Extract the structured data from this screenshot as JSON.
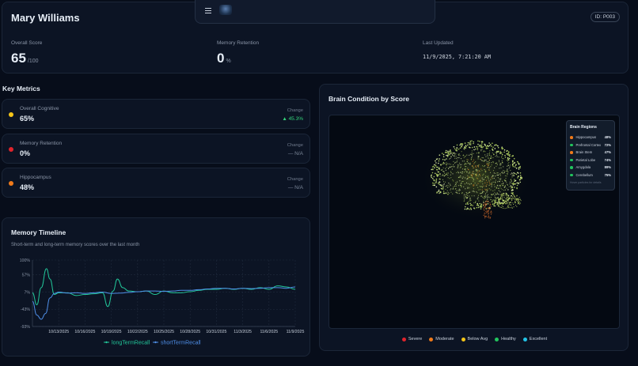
{
  "header": {
    "patient_name": "Mary Williams",
    "patient_id": "ID: P003",
    "overall_score_label": "Overall Score",
    "overall_score_value": "65",
    "overall_score_unit": "/100",
    "memory_retention_label": "Memory Retention",
    "memory_retention_value": "0",
    "memory_retention_unit": "%",
    "last_updated_label": "Last Updated",
    "last_updated_value": "11/9/2025, 7:21:20 AM"
  },
  "nav": {
    "menu_icon": "hamburger-menu-icon",
    "logo_icon": "brain-logo-icon"
  },
  "key_metrics": {
    "title": "Key Metrics",
    "items": [
      {
        "label": "Overall Cognitive",
        "value": "65%",
        "change_label": "Change",
        "change_value": "▲ 45.3%",
        "color": "#f5c518",
        "trend": "up"
      },
      {
        "label": "Memory Retention",
        "value": "0%",
        "change_label": "Change",
        "change_value": "— N/A",
        "color": "#e0242c",
        "trend": "none"
      },
      {
        "label": "Hippocampus",
        "value": "48%",
        "change_label": "Change",
        "change_value": "— N/A",
        "color": "#f07a1a",
        "trend": "none"
      }
    ]
  },
  "timeline": {
    "title": "Memory Timeline",
    "subtitle": "Short-term and long-term memory scores over the last month"
  },
  "chart_data": {
    "type": "line",
    "title": "Memory Timeline",
    "xlabel": "",
    "ylabel": "",
    "y_ticks": [
      "100%",
      "57%",
      "7%",
      "-43%",
      "-93%"
    ],
    "y_tick_values": [
      100,
      57,
      7,
      -43,
      -93
    ],
    "ylim": [
      -93,
      100
    ],
    "x_tick_labels": [
      "10/13/2025",
      "10/16/2025",
      "10/19/2025",
      "10/22/2025",
      "10/25/2025",
      "10/28/2025",
      "10/31/2025",
      "11/3/2025",
      "11/6/2025",
      "11/9/2025"
    ],
    "x_tick_days": [
      3,
      6,
      9,
      12,
      15,
      18,
      21,
      24,
      27,
      30
    ],
    "xlim": [
      0,
      30
    ],
    "grid": true,
    "legend_position": "bottom",
    "series": [
      {
        "name": "longTermRecall",
        "color": "#22c79a",
        "x": [
          0,
          0.5,
          1,
          1.6,
          2,
          2.5,
          3,
          4,
          5,
          6,
          7,
          8,
          8.6,
          9.2,
          9.7,
          10.3,
          11,
          12,
          13,
          14,
          15,
          16,
          17,
          18,
          19,
          20,
          21,
          22,
          23,
          24,
          25,
          26,
          27,
          28,
          29,
          30
        ],
        "y": [
          5,
          -30,
          20,
          75,
          45,
          0,
          5,
          5,
          -3,
          0,
          2,
          5,
          -35,
          10,
          45,
          20,
          10,
          8,
          10,
          0,
          10,
          5,
          5,
          8,
          12,
          15,
          15,
          18,
          15,
          18,
          15,
          20,
          15,
          25,
          22,
          15
        ]
      },
      {
        "name": "shortTermRecall",
        "color": "#4f8fe8",
        "x": [
          0,
          0.5,
          1,
          1.5,
          2,
          2.5,
          3,
          4,
          5,
          6,
          7,
          8,
          9,
          10,
          11,
          12,
          13,
          14,
          15,
          16,
          17,
          18,
          19,
          20,
          21,
          22,
          23,
          24,
          25,
          26,
          27,
          28,
          29,
          30
        ],
        "y": [
          -20,
          -60,
          -72,
          -55,
          -10,
          3,
          7,
          4,
          5,
          3,
          5,
          7,
          3,
          4,
          6,
          8,
          10,
          10,
          9,
          10,
          12,
          12,
          14,
          16,
          18,
          18,
          16,
          18,
          17,
          18,
          20,
          20,
          18,
          22
        ]
      }
    ]
  },
  "brain": {
    "title": "Brain Condition by Score",
    "regions_title": "Brain Regions",
    "regions_hint": "Hover particles for details",
    "regions": [
      {
        "name": "Hippocampus",
        "value": "48%",
        "color": "#f07a1a"
      },
      {
        "name": "Prefrontal Cortex",
        "value": "72%",
        "color": "#22c55e"
      },
      {
        "name": "Brain Stem",
        "value": "47%",
        "color": "#f07a1a"
      },
      {
        "name": "Parietal Lobe",
        "value": "74%",
        "color": "#22c55e"
      },
      {
        "name": "Amygdala",
        "value": "89%",
        "color": "#22c55e"
      },
      {
        "name": "Cerebellum",
        "value": "75%",
        "color": "#22c55e"
      }
    ],
    "legend": [
      {
        "label": "Severe",
        "color": "#e0242c"
      },
      {
        "label": "Moderate",
        "color": "#f07a1a"
      },
      {
        "label": "Below Avg",
        "color": "#f5c518"
      },
      {
        "label": "Healthy",
        "color": "#22c55e"
      },
      {
        "label": "Excellent",
        "color": "#22c3e6"
      }
    ]
  }
}
